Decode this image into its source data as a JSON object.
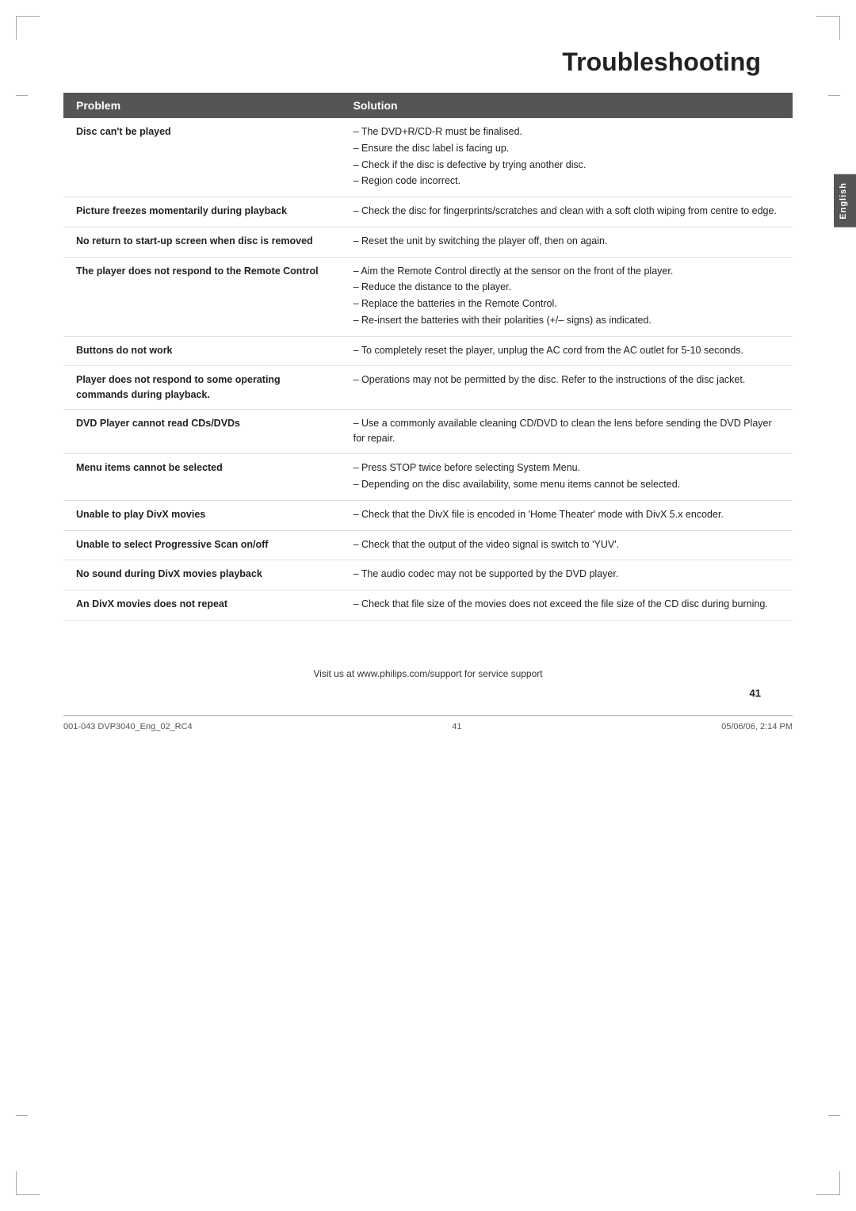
{
  "page": {
    "title": "Troubleshooting",
    "footer_url": "Visit us at www.philips.com/support for service support",
    "footer_left": "001-043 DVP3040_Eng_02_RC4",
    "footer_center": "41",
    "footer_right": "05/06/06, 2:14 PM",
    "page_number": "41",
    "language_tab": "English"
  },
  "table": {
    "headers": {
      "problem": "Problem",
      "solution": "Solution"
    },
    "rows": [
      {
        "problem": "Disc can't be played",
        "solutions": [
          "The DVD+R/CD-R must be finalised.",
          "Ensure the disc label is facing up.",
          "Check if the disc is defective by trying another disc.",
          "Region code incorrect."
        ]
      },
      {
        "problem": "Picture freezes momentarily during playback",
        "solutions": [
          "Check the disc for fingerprints/scratches and clean with a soft cloth wiping from centre to edge."
        ]
      },
      {
        "problem": "No return to start-up screen when disc is removed",
        "solutions": [
          "Reset the unit by switching the player off, then on again."
        ]
      },
      {
        "problem": "The player does not respond to the Remote Control",
        "solutions": [
          "Aim the Remote Control directly at the sensor on the front of the player.",
          "Reduce the distance to the player.",
          "Replace the batteries in the Remote Control.",
          "Re-insert the batteries with their polarities (+/– signs) as indicated."
        ]
      },
      {
        "problem": "Buttons do not work",
        "solutions": [
          "To completely reset the player, unplug the AC cord from the AC outlet for 5-10 seconds."
        ]
      },
      {
        "problem": "Player does not respond to some operating commands during playback.",
        "solutions": [
          "Operations may not be permitted by the disc. Refer to the instructions of  the disc jacket."
        ]
      },
      {
        "problem": "DVD Player cannot read CDs/DVDs",
        "solutions": [
          "Use a commonly available cleaning CD/DVD to clean the lens before sending the DVD Player for repair."
        ]
      },
      {
        "problem": "Menu items cannot be selected",
        "solutions": [
          "Press STOP twice before selecting System Menu.",
          "Depending on the disc availability, some menu items cannot be selected."
        ]
      },
      {
        "problem": "Unable to play DivX movies",
        "solutions": [
          "Check that the DivX file is encoded in 'Home Theater' mode with DivX 5.x encoder."
        ]
      },
      {
        "problem": "Unable to select Progressive Scan on/off",
        "solutions": [
          "Check that the output of the video signal is switch to 'YUV'."
        ]
      },
      {
        "problem": "No sound during DivX movies playback",
        "solutions": [
          "The audio codec may not be supported by the DVD player."
        ]
      },
      {
        "problem": "An DivX movies does not repeat",
        "solutions": [
          "Check that file size of the movies does not exceed the file size of the CD disc during burning."
        ]
      }
    ]
  }
}
